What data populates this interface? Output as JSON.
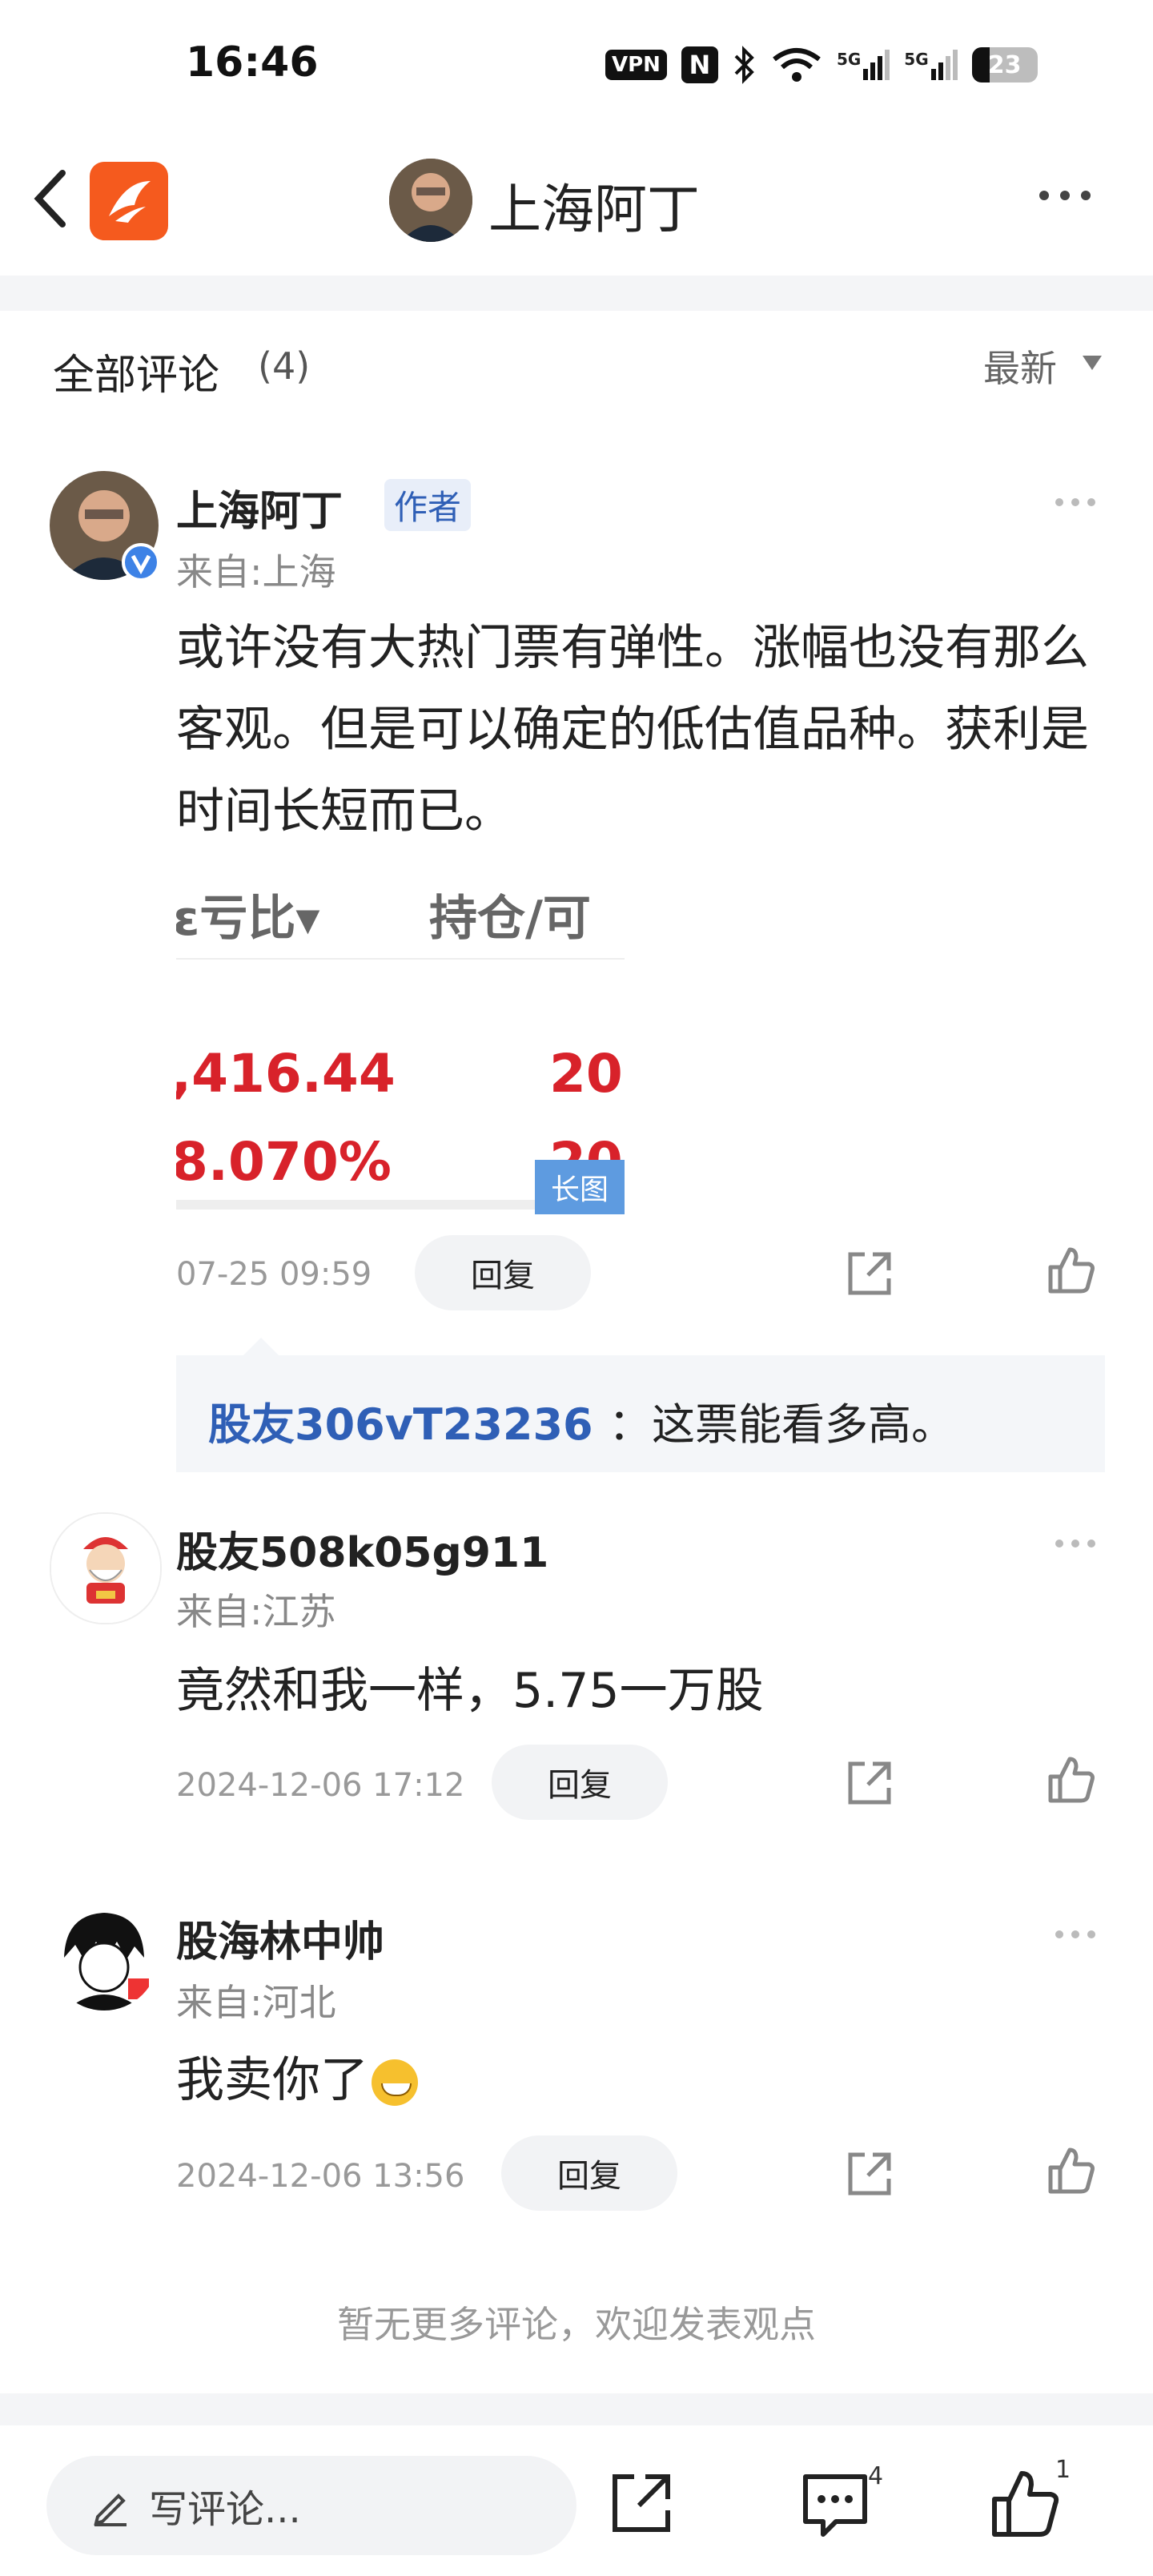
{
  "status_bar": {
    "time": "16:46",
    "vpn": "VPN",
    "nfc": "N",
    "signal1": "5G",
    "signal2": "5G",
    "battery": "23"
  },
  "header": {
    "title": "上海阿丁",
    "icons": [
      "back-chevron-icon",
      "app-logo-icon",
      "more-horizontal-icon"
    ]
  },
  "comments_section": {
    "title": "全部评论",
    "count": "(4)",
    "sort": "最新"
  },
  "comments": [
    {
      "username": "上海阿丁",
      "badge": "作者",
      "location": "来自:上海",
      "text": "或许没有大热门票有弹性。涨幅也没有那么客观。但是可以确定的低估值品种。获利是时间长短而已。",
      "attachment": {
        "head_left": "ɛ亏比▾",
        "head_right": "持仓/可",
        "value1": ",416.44",
        "value1_right": "20",
        "value2": "8.070%",
        "value2_right": "20",
        "tag": "长图"
      },
      "time": "07-25 09:59",
      "reply_label": "回复",
      "quoted": {
        "user": "股友306vT23236",
        "text": "：这票能看多高。"
      }
    },
    {
      "username": "股友508k05g911",
      "location": "来自:江苏",
      "text": "竟然和我一样，5.75一万股",
      "time": "2024-12-06 17:12",
      "reply_label": "回复"
    },
    {
      "username": "股海林中帅",
      "location": "来自:河北",
      "text": "我卖你了",
      "time": "2024-12-06 13:56",
      "reply_label": "回复"
    }
  ],
  "end_text": "暂无更多评论，欢迎发表观点",
  "bottom_bar": {
    "write_placeholder": "写评论...",
    "comment_count": "4",
    "like_count": "1"
  },
  "colors": {
    "brand_orange": "#f55a1e",
    "link_blue": "#2f5fb6",
    "price_red": "#d8222a"
  }
}
